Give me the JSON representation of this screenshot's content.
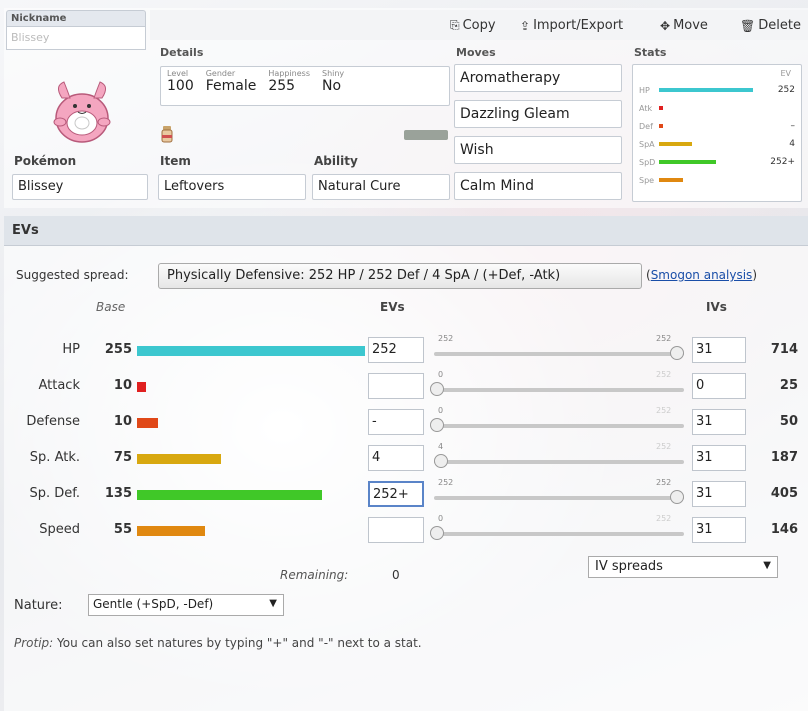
{
  "colors": {
    "hp": "#3cc7cf",
    "attack": "#e02020",
    "defense": "#e04818",
    "spatk": "#d8a810",
    "spdef": "#40c828",
    "speed": "#e08810"
  },
  "nickname": {
    "label": "Nickname",
    "placeholder": "Blissey"
  },
  "actions": {
    "copy": "Copy",
    "import_export": "Import/Export",
    "move": "Move",
    "delete": "Delete"
  },
  "details": {
    "title": "Details",
    "level_label": "Level",
    "level": "100",
    "gender_label": "Gender",
    "gender": "Female",
    "happiness_label": "Happiness",
    "happiness": "255",
    "shiny_label": "Shiny",
    "shiny": "No"
  },
  "pokemon": {
    "label": "Pokémon",
    "value": "Blissey"
  },
  "item": {
    "label": "Item",
    "value": "Leftovers"
  },
  "ability": {
    "label": "Ability",
    "value": "Natural Cure"
  },
  "moves": {
    "title": "Moves",
    "list": [
      "Aromatherapy",
      "Dazzling Gleam",
      "Wish",
      "Calm Mind"
    ]
  },
  "stats": {
    "title": "Stats",
    "ev_header": "EV",
    "rows": [
      {
        "label": "HP",
        "ev": "252",
        "fill": 0.85
      },
      {
        "label": "Atk",
        "ev": "",
        "fill": 0.04
      },
      {
        "label": "Def",
        "ev": "–",
        "fill": 0.04
      },
      {
        "label": "SpA",
        "ev": "4",
        "fill": 0.3
      },
      {
        "label": "SpD",
        "ev": "252+",
        "fill": 0.52
      },
      {
        "label": "Spe",
        "ev": "",
        "fill": 0.22
      }
    ]
  },
  "evs": {
    "title": "EVs",
    "suggested_label": "Suggested spread:",
    "suggested_value": "Physically Defensive: 252 HP / 252 Def / 4 SpA / (+Def, -Atk)",
    "smogon_link": "Smogon analysis",
    "col_base": "Base",
    "col_evs": "EVs",
    "col_ivs": "IVs",
    "slider_max": "252",
    "rows": [
      {
        "name": "HP",
        "base": "255",
        "ev": "252",
        "slider_label": "252",
        "iv": "31",
        "total": "714",
        "fill": 1.0,
        "slider": 1.0
      },
      {
        "name": "Attack",
        "base": "10",
        "ev": "",
        "slider_label": "0",
        "iv": "0",
        "total": "25",
        "fill": 0.04,
        "slider": 0.0
      },
      {
        "name": "Defense",
        "base": "10",
        "ev": "-",
        "slider_label": "0",
        "iv": "31",
        "total": "50",
        "fill": 0.09,
        "slider": 0.0
      },
      {
        "name": "Sp. Atk.",
        "base": "75",
        "ev": "4",
        "slider_label": "4",
        "iv": "31",
        "total": "187",
        "fill": 0.37,
        "slider": 0.016
      },
      {
        "name": "Sp. Def.",
        "base": "135",
        "ev": "252+",
        "slider_label": "252",
        "iv": "31",
        "total": "405",
        "fill": 0.81,
        "slider": 1.0
      },
      {
        "name": "Speed",
        "base": "55",
        "ev": "",
        "slider_label": "0",
        "iv": "31",
        "total": "146",
        "fill": 0.3,
        "slider": 0.0
      }
    ],
    "remaining_label": "Remaining:",
    "remaining_value": "0",
    "iv_spreads": "IV spreads",
    "nature_label": "Nature:",
    "nature_value": "Gentle (+SpD, -Def)",
    "protip_label": "Protip:",
    "protip_text": " You can also set natures by typing \"+\" and \"-\" next to a stat."
  }
}
